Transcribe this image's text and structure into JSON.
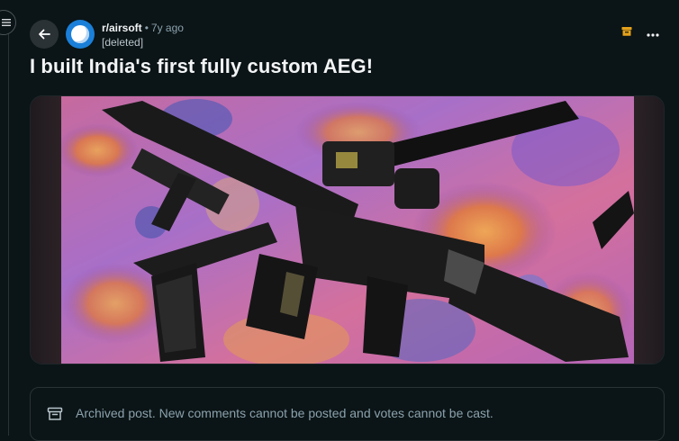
{
  "post": {
    "subreddit": "r/airsoft",
    "separator": "•",
    "age": "7y ago",
    "author": "[deleted]",
    "title": "I built India's first fully custom AEG!"
  },
  "image": {
    "alt": "Custom airsoft rifle and pistol lying on a colorful paisley fabric"
  },
  "notice": {
    "text": "Archived post. New comments cannot be posted and votes cannot be cast."
  },
  "icons": {
    "menu": "hamburger-icon",
    "back": "arrow-left-icon",
    "archive": "archive-icon",
    "more": "more-horizontal-icon"
  },
  "colors": {
    "background": "#0b1416",
    "accent_archive": "#e4a11b",
    "avatar_blue": "#1a7fd8",
    "muted_text": "#8ba2ad"
  }
}
